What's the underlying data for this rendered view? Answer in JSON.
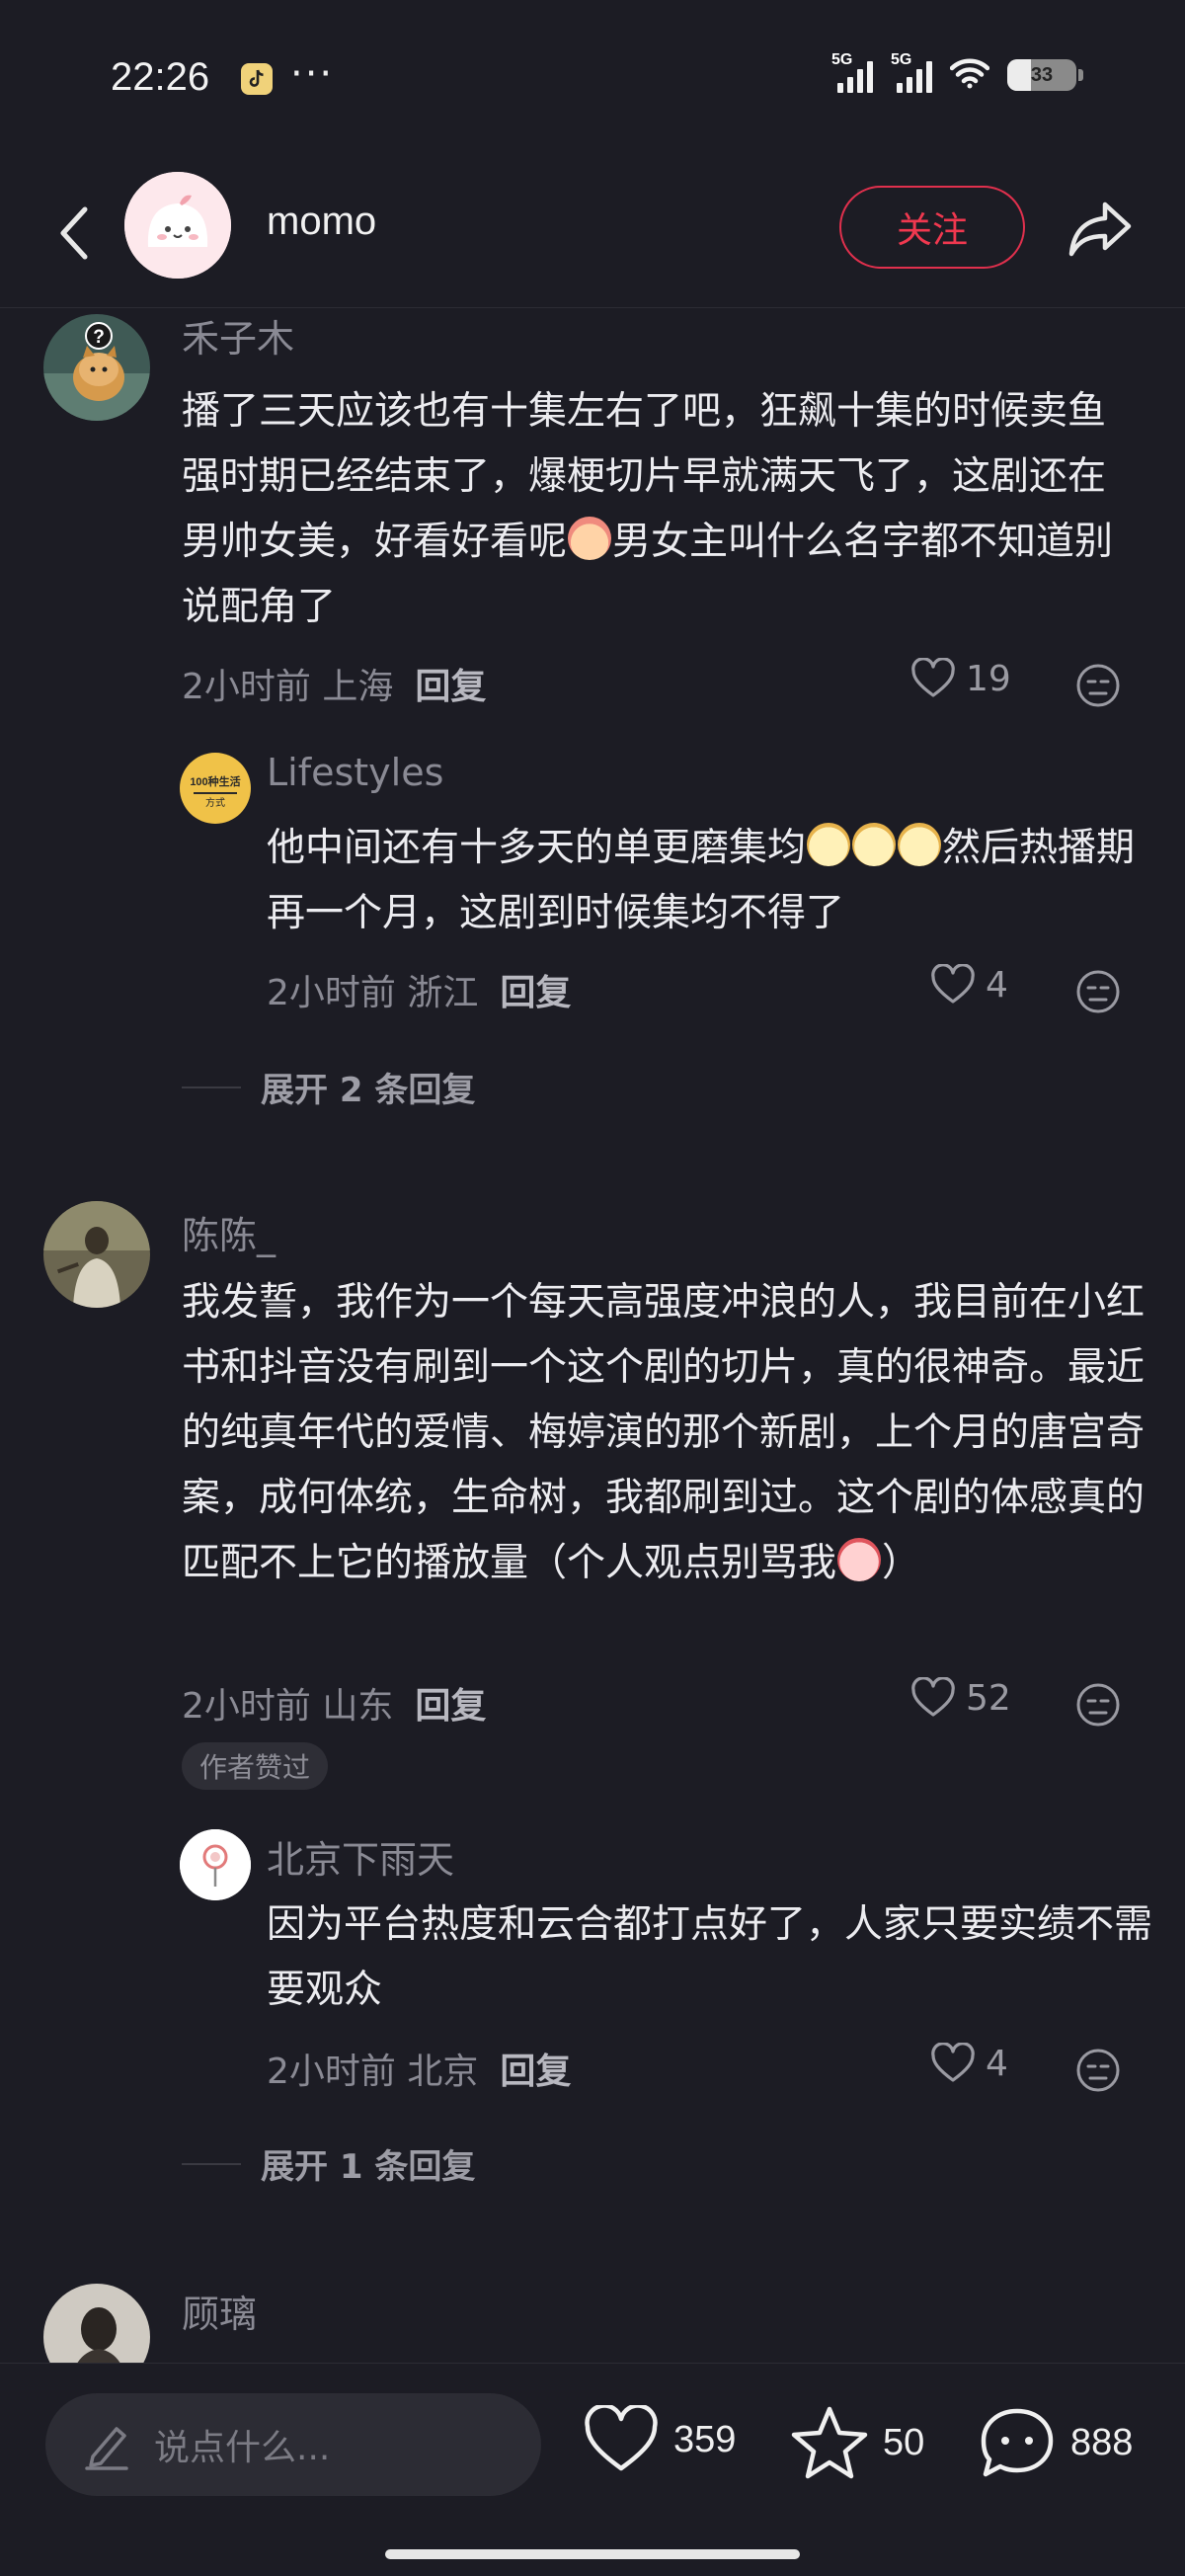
{
  "status": {
    "time": "22:26",
    "dots": "···",
    "net1": "5G",
    "net2": "5G",
    "battery": "33"
  },
  "header": {
    "name": "momo",
    "follow_label": "关注"
  },
  "comments": [
    {
      "user": "禾子木",
      "text_parts": [
        "播了三天应该也有十集左右了吧，狂飙十集的时候卖鱼强时期已经结束了，爆梗切片早就满天飞了，这剧还在男帅女美，好看好看呢",
        "男女主叫什么名字都不知道别说配角了"
      ],
      "time": "2小时前 上海",
      "reply_label": "回复",
      "likes": "19",
      "replies": [
        {
          "user": "Lifestyles",
          "text_parts": [
            "他中间还有十多天的单更磨集均",
            "然后热播期再一个月，这剧到时候集均不得了"
          ],
          "time": "2小时前 浙江",
          "reply_label": "回复",
          "likes": "4"
        }
      ],
      "expand_label": "展开 2 条回复"
    },
    {
      "user": "陈陈_",
      "text_parts": [
        "我发誓，我作为一个每天高强度冲浪的人，我目前在小红书和抖音没有刷到一个这个剧的切片，真的很神奇。最近的纯真年代的爱情、梅婷演的那个新剧，上个月的唐宫奇案，成何体统，生命树，我都刷到过。这个剧的体感真的匹配不上它的播放量（个人观点别骂我",
        "）"
      ],
      "time": "2小时前 山东",
      "reply_label": "回复",
      "likes": "52",
      "badge": "作者赞过",
      "replies": [
        {
          "user": "北京下雨天",
          "text_parts": [
            "因为平台热度和云合都打点好了，人家只要实绩不需要观众"
          ],
          "time": "2小时前 北京",
          "reply_label": "回复",
          "likes": "4"
        }
      ],
      "expand_label": "展开 1 条回复"
    },
    {
      "user": "顾璃"
    }
  ],
  "bottom": {
    "input_placeholder": "说点什么...",
    "likes": "359",
    "favorites": "50",
    "comments": "888"
  }
}
